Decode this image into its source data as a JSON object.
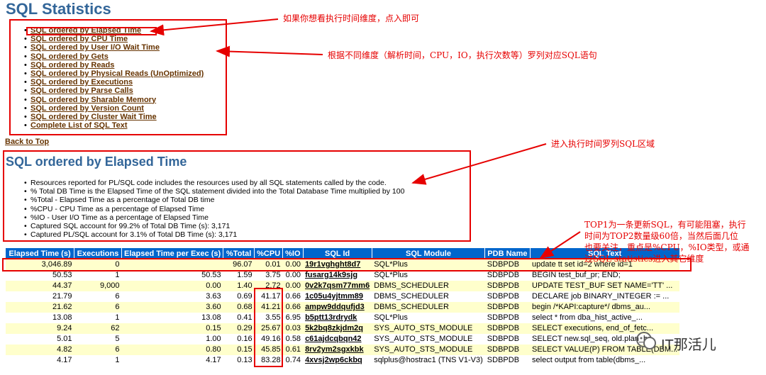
{
  "title": "SQL Statistics",
  "toc": [
    "SQL ordered by Elapsed Time",
    "SQL ordered by CPU Time",
    "SQL ordered by User I/O Wait Time",
    "SQL ordered by Gets",
    "SQL ordered by Reads",
    "SQL ordered by Physical Reads (UnOptimized)",
    "SQL ordered by Executions",
    "SQL ordered by Parse Calls",
    "SQL ordered by Sharable Memory",
    "SQL ordered by Version Count",
    "SQL ordered by Cluster Wait Time",
    "Complete List of SQL Text"
  ],
  "back_to_top": "Back to Top",
  "section_title": "SQL ordered by Elapsed Time",
  "notes": [
    "Resources reported for PL/SQL code includes the resources used by all SQL statements called by the code.",
    "% Total DB Time is the Elapsed Time of the SQL statement divided into the Total Database Time multiplied by 100",
    "%Total - Elapsed Time as a percentage of Total DB time",
    "%CPU - CPU Time as a percentage of Elapsed Time",
    "%IO - User I/O Time as a percentage of Elapsed Time",
    "Captured SQL account for 99.2% of Total DB Time (s): 3,171",
    "Captured PL/SQL account for 3.1% of Total DB Time (s): 3,171"
  ],
  "annotations": {
    "a1": "如果你想看执行时间维度，点入即可",
    "a2": "根据不同维度（解析时间，CPU，IO，执行次数等）罗列对应SQL语句",
    "a3": "进入执行时间罗列SQL区域",
    "a4_lines": [
      "TOP1为一条更新SQL，有可能阻塞，执行",
      "时间为TOP2数量级60倍，当然后面几位",
      "也要关注，重点是%CPU，%IO类型，或通",
      "过SQL statistics进入其它维度"
    ]
  },
  "table": {
    "headers": [
      "Elapsed Time (s)",
      "Executions",
      "Elapsed Time per Exec (s)",
      "%Total",
      "%CPU",
      "%IO",
      "SQL Id",
      "SQL Module",
      "PDB Name",
      "SQL Text"
    ],
    "rows": [
      [
        "3,046.89",
        "0",
        "",
        "96.07",
        "0.01",
        "0.00",
        "19r1vghght8d7",
        "SQL*Plus",
        "SDBPDB",
        "update tt set id=2 where id=1"
      ],
      [
        "50.53",
        "1",
        "50.53",
        "1.59",
        "3.75",
        "0.00",
        "fusarg14k9sjg",
        "SQL*Plus",
        "SDBPDB",
        "BEGIN test_buf_pr; END;"
      ],
      [
        "44.37",
        "9,000",
        "0.00",
        "1.40",
        "2.72",
        "0.00",
        "0v2k7qsm77mm6",
        "DBMS_SCHEDULER",
        "SDBPDB",
        "UPDATE TEST_BUF SET NAME='TT' ..."
      ],
      [
        "21.79",
        "6",
        "3.63",
        "0.69",
        "41.17",
        "0.66",
        "1c05u4yjtmm89",
        "DBMS_SCHEDULER",
        "SDBPDB",
        "DECLARE job BINARY_INTEGER := ..."
      ],
      [
        "21.62",
        "6",
        "3.60",
        "0.68",
        "41.21",
        "0.66",
        "ampw9ddqufjd3",
        "DBMS_SCHEDULER",
        "SDBPDB",
        "begin /*KAPI:capture*/ dbms_au..."
      ],
      [
        "13.08",
        "1",
        "13.08",
        "0.41",
        "3.55",
        "6.95",
        "b5ptt13rdrydk",
        "SQL*Plus",
        "SDBPDB",
        "select * from dba_hist_active_..."
      ],
      [
        "9.24",
        "62",
        "0.15",
        "0.29",
        "25.67",
        "0.03",
        "5k2bq8zkjdm2q",
        "SYS_AUTO_STS_MODULE",
        "SDBPDB",
        "SELECT executions, end_of_fetc..."
      ],
      [
        "5.01",
        "5",
        "1.00",
        "0.16",
        "49.16",
        "0.58",
        "c61ajdcqbqn42",
        "SYS_AUTO_STS_MODULE",
        "SDBPDB",
        "SELECT new.sql_seq, old.plan_h..."
      ],
      [
        "4.82",
        "6",
        "0.80",
        "0.15",
        "45.85",
        "0.61",
        "8rv2ym2sgxkbk",
        "SYS_AUTO_STS_MODULE",
        "SDBPDB",
        "SELECT VALUE(P) FROM TABLE(DBM..."
      ],
      [
        "4.17",
        "1",
        "4.17",
        "0.13",
        "83.28",
        "0.74",
        "4xvsj2wp6ckbq",
        "sqlplus@hostrac1 (TNS V1-V3)",
        "SDBPDB",
        "select output from table(dbms_..."
      ]
    ]
  },
  "watermark": "IT那活儿",
  "colors": {
    "heading": "#336699",
    "link": "#663300",
    "header_bg": "#0066cc",
    "row_alt": "#ffffcc",
    "annotation": "#e60000"
  }
}
